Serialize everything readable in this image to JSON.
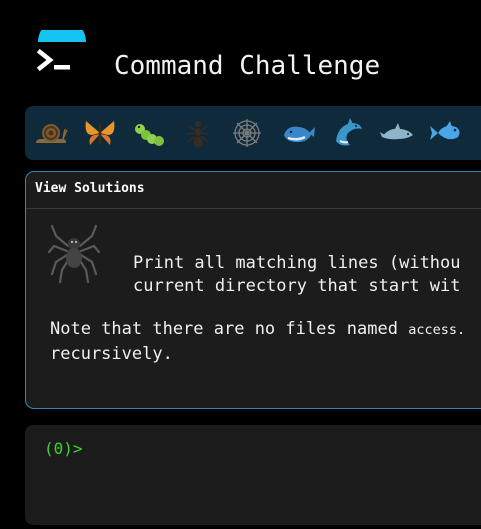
{
  "header": {
    "title": "Command Challenge",
    "logo_icon": "terminal-prompt-icon",
    "logo_color": "#13c4f2"
  },
  "levels": [
    {
      "icon": "snail-icon"
    },
    {
      "icon": "butterfly-icon"
    },
    {
      "icon": "caterpillar-icon"
    },
    {
      "icon": "ant-icon"
    },
    {
      "icon": "spider-web-icon"
    },
    {
      "icon": "whale-icon"
    },
    {
      "icon": "dolphin-icon"
    },
    {
      "icon": "dolphin-icon"
    },
    {
      "icon": "fish-icon"
    }
  ],
  "card": {
    "header_label": "View Solutions",
    "icon": "spider-icon",
    "description_line1": "Print all matching lines (withou",
    "description_line2": "current directory that start wit",
    "note_prefix": "Note that there are no files named ",
    "note_code": "access.",
    "note_line2": "recursively."
  },
  "terminal": {
    "prompt": "(0)>",
    "input_value": ""
  },
  "colors": {
    "background": "#000000",
    "strip": "#0e2a3b",
    "card_border": "#2d89b5",
    "prompt_green": "#3ed62a"
  }
}
